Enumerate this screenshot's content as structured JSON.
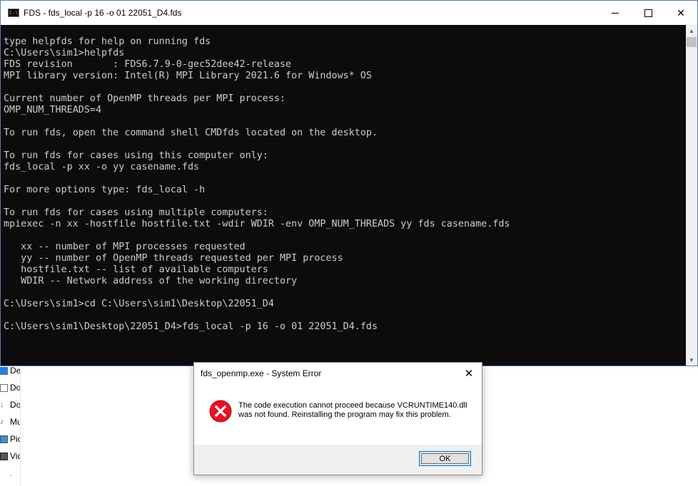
{
  "console": {
    "title": "FDS - fds_local  -p 16 -o 01 22051_D4.fds",
    "lines": [
      "type helpfds for help on running fds",
      "C:\\Users\\sim1>helpfds",
      "FDS revision       : FDS6.7.9-0-gec52dee42-release",
      "MPI library version: Intel(R) MPI Library 2021.6 for Windows* OS",
      "",
      "Current number of OpenMP threads per MPI process:",
      "OMP_NUM_THREADS=4",
      "",
      "To run fds, open the command shell CMDfds located on the desktop.",
      "",
      "To run fds for cases using this computer only:",
      "fds_local -p xx -o yy casename.fds",
      "",
      "For more options type: fds_local -h",
      "",
      "To run fds for cases using multiple computers:",
      "mpiexec -n xx -hostfile hostfile.txt -wdir WDIR -env OMP_NUM_THREADS yy fds casename.fds",
      "",
      "   xx -- number of MPI processes requested",
      "   yy -- number of OpenMP threads requested per MPI process",
      "   hostfile.txt -- list of available computers",
      "   WDIR -- Network address of the working directory",
      "",
      "C:\\Users\\sim1>cd C:\\Users\\sim1\\Desktop\\22051_D4",
      "",
      "C:\\Users\\sim1\\Desktop\\22051_D4>fds_local -p 16 -o 01 22051_D4.fds"
    ]
  },
  "explorer": {
    "nav_items": [
      {
        "label": "De",
        "icon": "desktop-icon",
        "color": "#2b7cd3"
      },
      {
        "label": "Do",
        "icon": "documents-icon",
        "color": "#6f6f6f"
      },
      {
        "label": "Do",
        "icon": "downloads-icon",
        "color": "#2b7cd3"
      },
      {
        "label": "Mu",
        "icon": "music-icon",
        "color": "#2b7cd3"
      },
      {
        "label": "Pic",
        "icon": "pictures-icon",
        "color": "#3a8fd8"
      },
      {
        "label": "Vid",
        "icon": "videos-icon",
        "color": "#555555"
      }
    ],
    "dot": "."
  },
  "dialog": {
    "title": "fds_openmp.exe - System Error",
    "message": "The code execution cannot proceed because VCRUNTIME140.dll was not found. Reinstalling the program may fix this problem.",
    "ok_label": "OK",
    "icon": "error-icon",
    "icon_color": "#e81123"
  },
  "colors": {
    "console_bg": "#0c0c0c",
    "console_text": "#cccccc",
    "accent": "#0078d7"
  }
}
